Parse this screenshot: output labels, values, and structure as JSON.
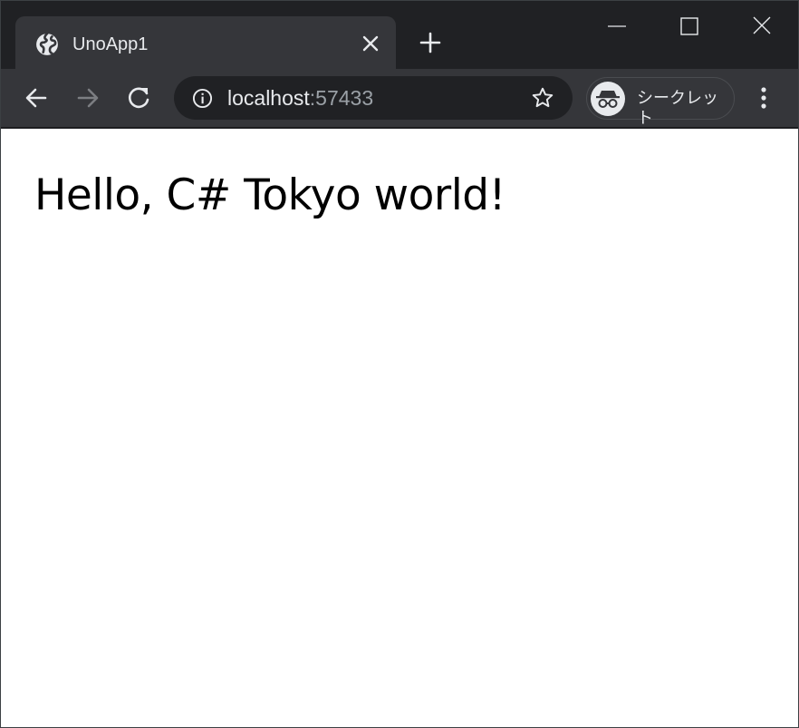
{
  "tab": {
    "title": "UnoApp1",
    "favicon": "globe-icon",
    "close_icon": "close-icon"
  },
  "window_controls": {
    "minimize": "minimize-icon",
    "maximize": "maximize-icon",
    "close": "close-icon"
  },
  "toolbar": {
    "back_icon": "arrow-left-icon",
    "forward_icon": "arrow-right-icon",
    "reload_icon": "reload-icon",
    "menu_icon": "kebab-menu-icon"
  },
  "omnibox": {
    "host": "localhost",
    "port": ":57433",
    "info_icon": "info-icon",
    "bookmark_icon": "star-icon"
  },
  "profile": {
    "label": "シークレット",
    "icon": "incognito-icon"
  },
  "page": {
    "heading": "Hello, C# Tokyo world!"
  },
  "colors": {
    "tab_strip_bg": "#202124",
    "toolbar_bg": "#35363a",
    "omnibox_bg": "#202124",
    "text_light": "#e8eaed",
    "text_dim": "#9aa0a6",
    "page_bg": "#ffffff"
  }
}
